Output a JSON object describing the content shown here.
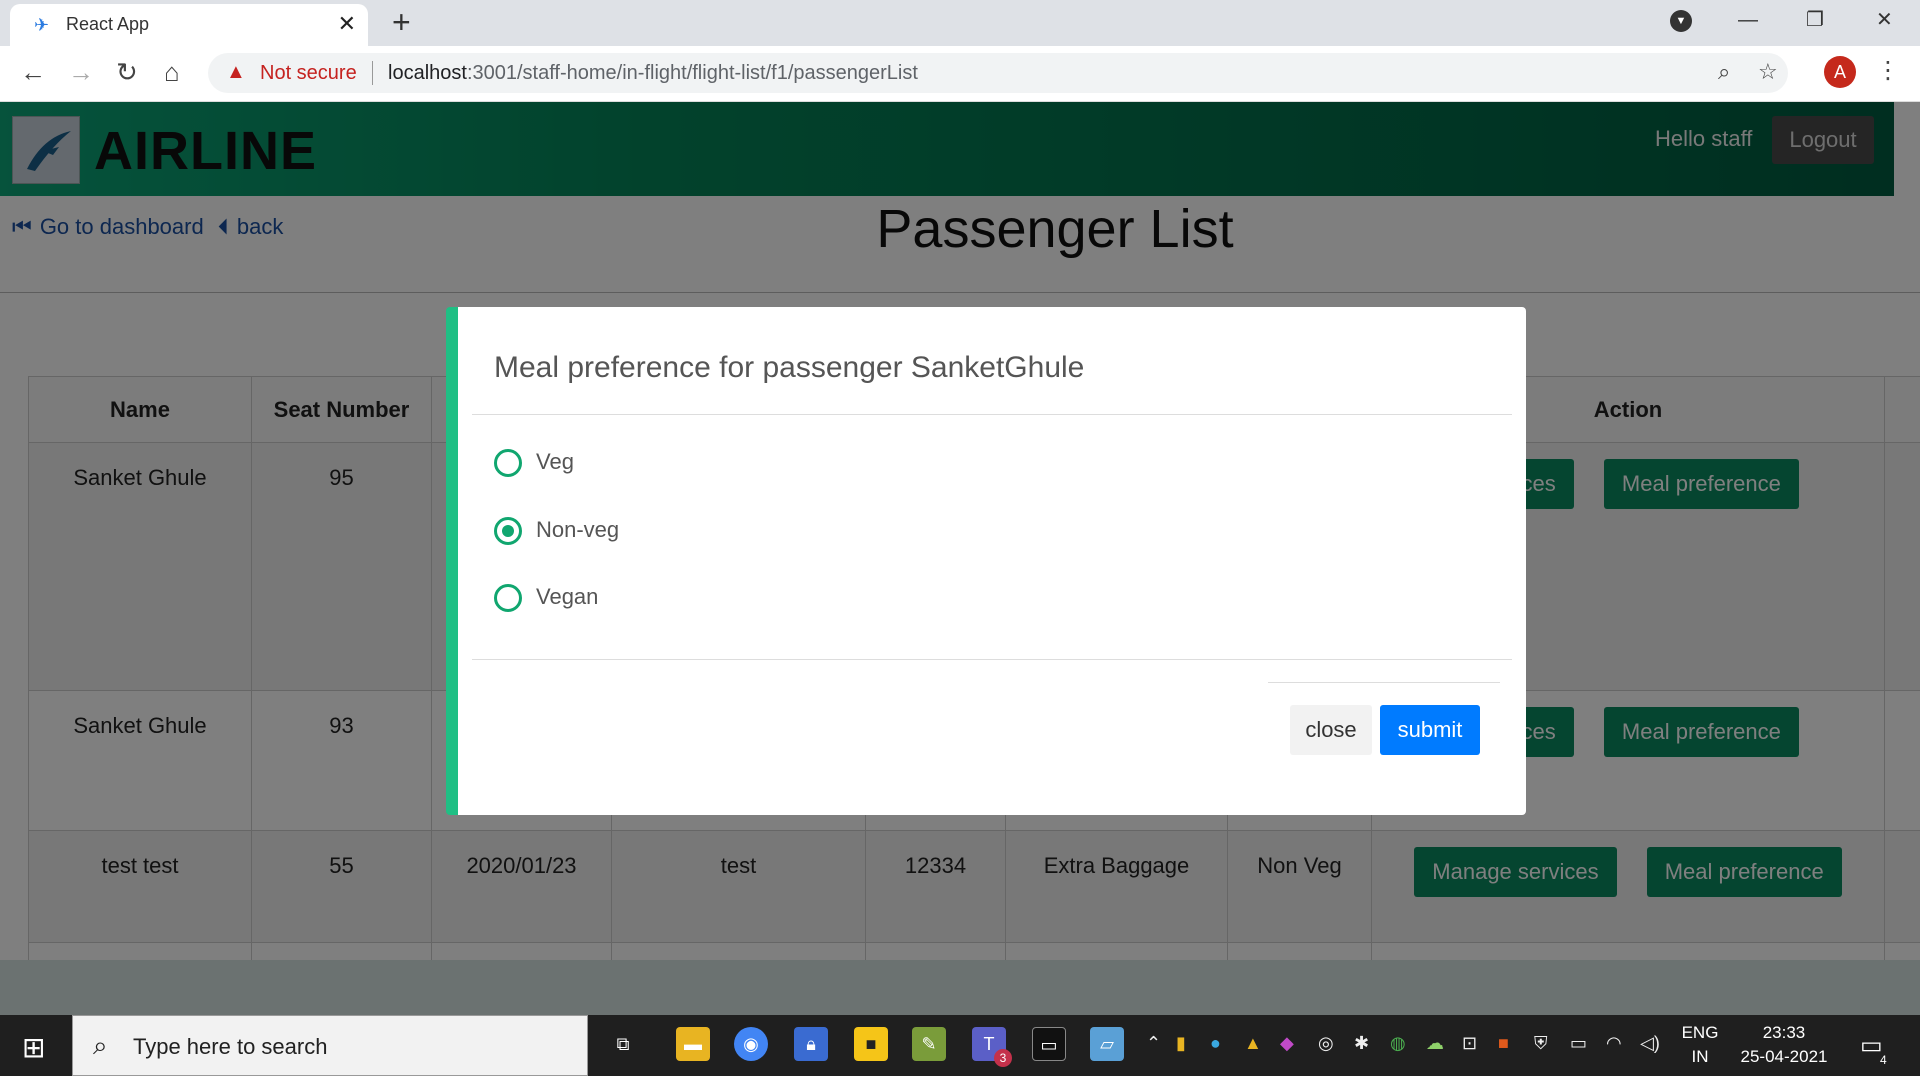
{
  "browser": {
    "tab_title": "React App",
    "not_secure": "Not secure",
    "url_host": "localhost",
    "url_path": ":3001/staff-home/in-flight/flight-list/f1/passengerList",
    "profile_initial": "A"
  },
  "header": {
    "logo": "AIRLINE",
    "greeting": "Hello staff",
    "logout": "Logout"
  },
  "nav": {
    "dashboard": "Go to dashboard",
    "back": "back"
  },
  "page": {
    "title": "Passenger List"
  },
  "table": {
    "headers": [
      "Name",
      "Seat Number",
      "",
      "",
      "",
      "",
      "",
      "Action"
    ],
    "rows": [
      {
        "name": "Sanket Ghule",
        "seat": "95",
        "c3": "",
        "c4": "",
        "c5": "",
        "c6": "",
        "c7": "",
        "manage": "services",
        "meal": "Meal preference"
      },
      {
        "name": "Sanket Ghule",
        "seat": "93",
        "c3": "",
        "c4": "",
        "c5": "",
        "c6": "",
        "c7": "",
        "manage": "services",
        "meal": "Meal preference"
      },
      {
        "name": "test test",
        "seat": "55",
        "c3": "2020/01/23",
        "c4": "test",
        "c5": "12334",
        "c6": "Extra Baggage",
        "c7": "Non Veg",
        "manage": "Manage services",
        "meal": "Meal preference"
      }
    ]
  },
  "modal": {
    "title": "Meal preference for passenger  SanketGhule",
    "options": [
      "Veg",
      "Non-veg",
      "Vegan"
    ],
    "selected": "Non-veg",
    "close": "close",
    "submit": "submit"
  },
  "taskbar": {
    "search_placeholder": "Type here to search",
    "lang_line1": "ENG",
    "lang_line2": "IN",
    "time": "23:33",
    "date": "25-04-2021",
    "teams_badge": "3",
    "notif_count": "4"
  },
  "colors": {
    "navbar_start": "#0ca678",
    "navbar_end": "#005c40",
    "button_green": "#0a8a60",
    "submit_blue": "#007bff",
    "modal_accent": "#1fbf84"
  }
}
